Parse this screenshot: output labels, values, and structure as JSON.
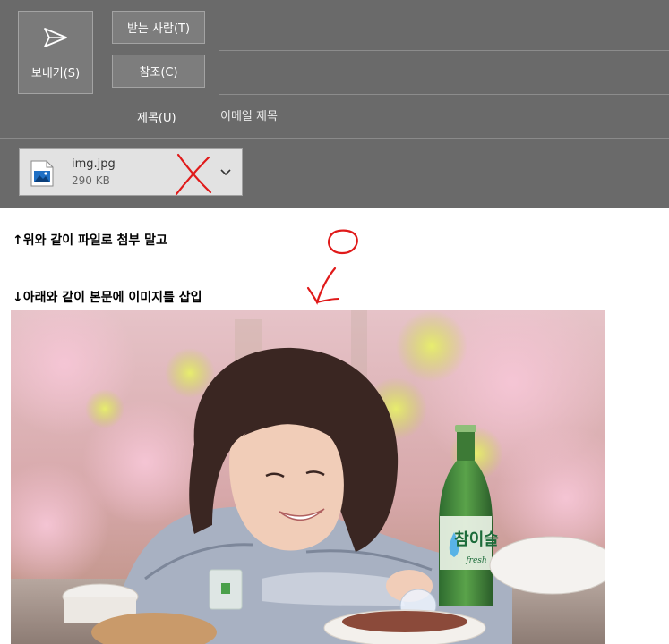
{
  "compose": {
    "send_label": "보내기(S)",
    "to_label": "받는 사람(T)",
    "cc_label": "참조(C)",
    "subject_label": "제목(U)",
    "subject_value": "이메일 제목"
  },
  "attachment": {
    "name": "img.jpg",
    "size": "290 KB"
  },
  "body": {
    "line1": "↑위와 같이 파일로 첨부 말고",
    "line2": "↓아래와 같이 본문에 이미지를 삽입"
  },
  "photo": {
    "bottle_label": "참이슬",
    "bottle_sub": "fresh"
  },
  "colors": {
    "header_bg": "#6a6a6a",
    "annotation_red": "#e01a1a",
    "attachment_bg": "#e2e2e2"
  }
}
